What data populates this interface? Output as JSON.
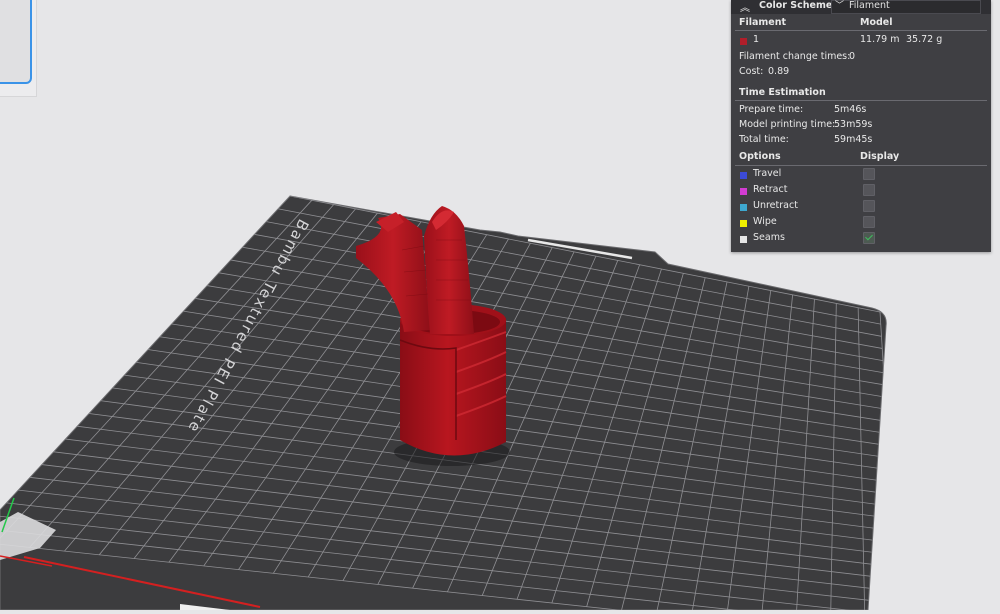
{
  "color_scheme": {
    "label": "Color Scheme",
    "selected": "Filament"
  },
  "filament": {
    "header_filament": "Filament",
    "header_model": "Model",
    "items": [
      {
        "name": "1",
        "length": "11.79 m",
        "weight": "35.72 g",
        "color": "#b01e2a"
      }
    ],
    "change_times_label": "Filament change times:",
    "change_times_value": "0",
    "cost_label": "Cost:",
    "cost_value": "0.89"
  },
  "time_estimation": {
    "header": "Time Estimation",
    "prepare_label": "Prepare time:",
    "prepare_value": "5m46s",
    "model_label": "Model printing time:",
    "model_value": "53m59s",
    "total_label": "Total time:",
    "total_value": "59m45s"
  },
  "options": {
    "header_options": "Options",
    "header_display": "Display",
    "items": [
      {
        "label": "Travel",
        "color": "#3c4bd8",
        "checked": false
      },
      {
        "label": "Retract",
        "color": "#d23cd2",
        "checked": false
      },
      {
        "label": "Unretract",
        "color": "#3ea8d0",
        "checked": false
      },
      {
        "label": "Wipe",
        "color": "#f0f000",
        "checked": false
      },
      {
        "label": "Seams",
        "color": "#e6e6e6",
        "checked": true
      }
    ]
  },
  "plate": {
    "label": "Bambu Textured PEI Plate",
    "bed_color": "#3c3c3e",
    "model_color": "#a8121c"
  }
}
